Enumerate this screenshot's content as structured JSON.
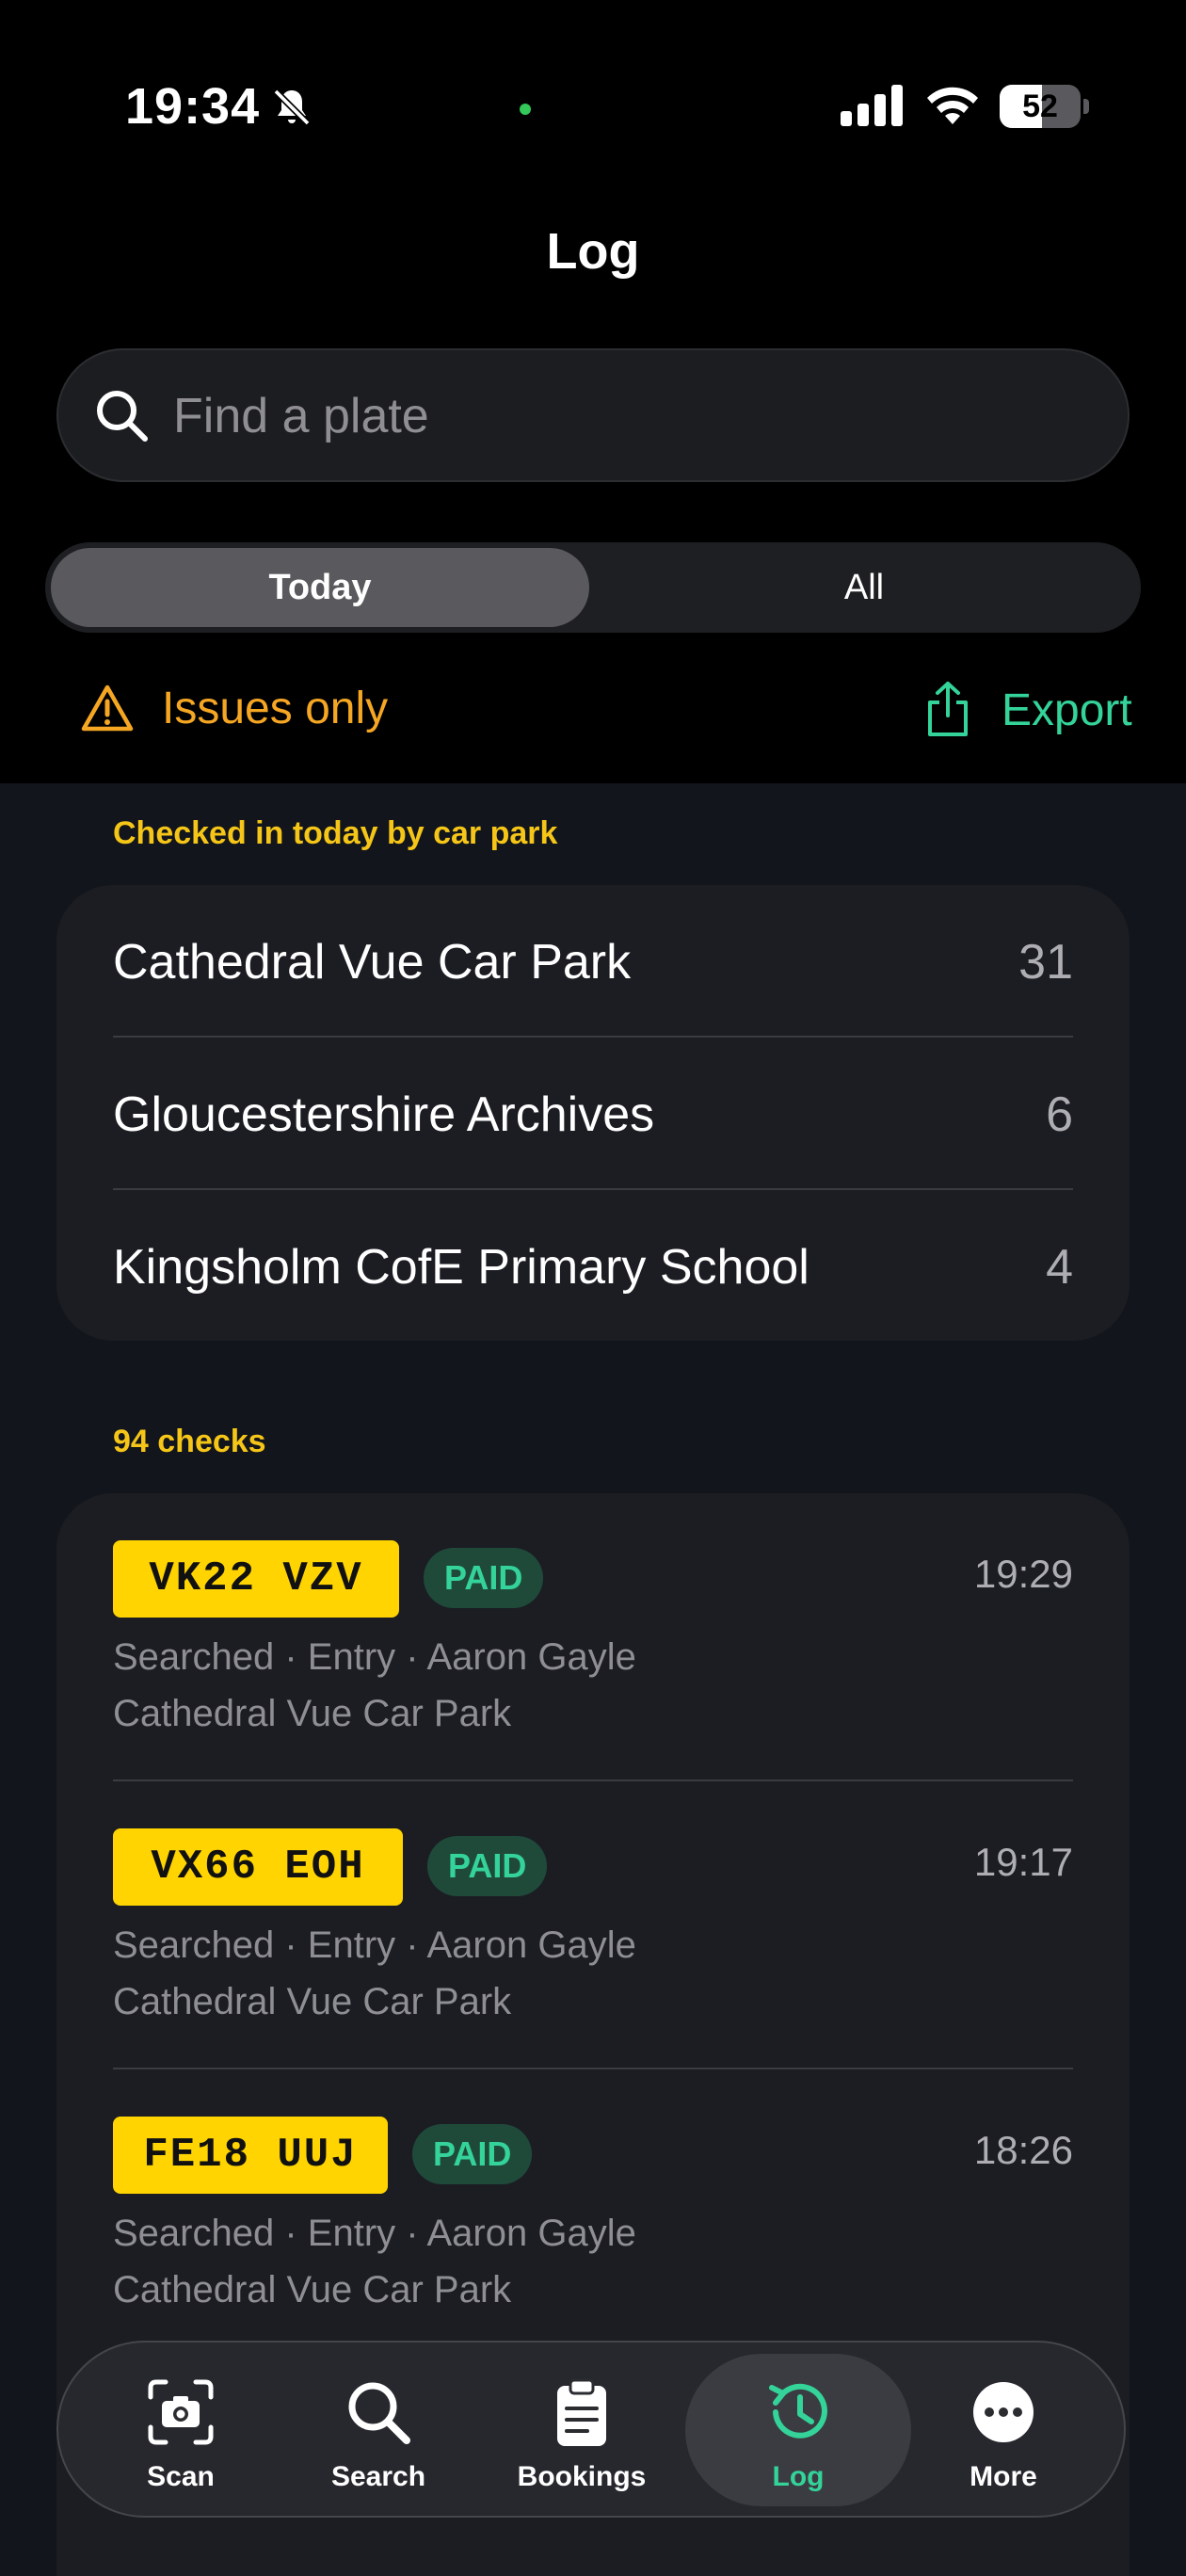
{
  "status_bar": {
    "time": "19:34",
    "battery": "52"
  },
  "header": {
    "title": "Log"
  },
  "search": {
    "placeholder": "Find a plate"
  },
  "segments": {
    "today": "Today",
    "all": "All"
  },
  "filters": {
    "issues_label": "Issues only",
    "export_label": "Export"
  },
  "car_parks": {
    "heading": "Checked in today by car park",
    "items": [
      {
        "name": "Cathedral Vue Car Park",
        "count": "31"
      },
      {
        "name": "Gloucestershire Archives",
        "count": "6"
      },
      {
        "name": "Kingsholm CofE Primary School",
        "count": "4"
      }
    ]
  },
  "checks": {
    "heading": "94 checks",
    "items": [
      {
        "plate": "VK22 VZV",
        "status": "PAID",
        "time": "19:29",
        "meta": "Searched · Entry · Aaron Gayle",
        "park": "Cathedral Vue Car Park"
      },
      {
        "plate": "VX66 EOH",
        "status": "PAID",
        "time": "19:17",
        "meta": "Searched · Entry · Aaron Gayle",
        "park": "Cathedral Vue Car Park"
      },
      {
        "plate": "FE18 UUJ",
        "status": "PAID",
        "time": "18:26",
        "meta": "Searched · Entry · Aaron Gayle",
        "park": "Cathedral Vue Car Park"
      }
    ]
  },
  "tabbar": {
    "scan": "Scan",
    "search": "Search",
    "bookings": "Bookings",
    "log": "Log",
    "more": "More"
  },
  "colors": {
    "accent_green": "#34d399",
    "warning_orange": "#f5a623",
    "section_yellow": "#f5c518",
    "plate_yellow": "#ffd400"
  }
}
